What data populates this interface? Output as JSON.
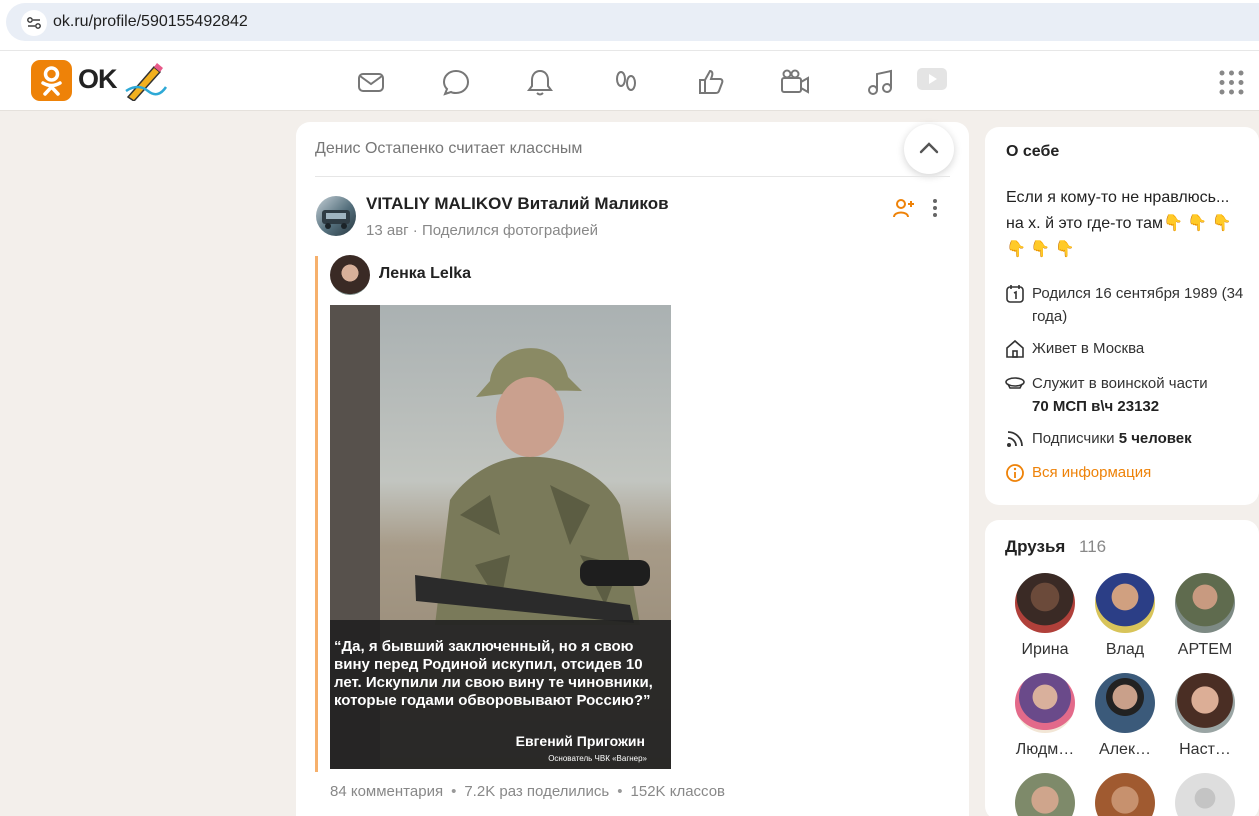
{
  "browser": {
    "url": "ok.ru/profile/590155492842"
  },
  "header": {
    "logo_text": "OK"
  },
  "feed": {
    "liked_by": "Денис Остапенко считает классным",
    "post": {
      "author": "VITALIY MALIKOV Виталий Маликов",
      "meta": "13 авг · Поделился фотографией",
      "repost_author": "Ленка Lelka",
      "photo_quote": "“Да, я бывший заключенный, но я свою вину перед Родиной искупил, отсидев 10 лет. Искупили ли свою вину те чиновники, которые годами обворовывают Россию?”",
      "photo_author": "Евгений Пригожин",
      "photo_author_role": "Основатель ЧВК «Вагнер»",
      "comments": "84 комментария",
      "shares": "7.2K раз поделились",
      "likes": "152K классов"
    }
  },
  "about": {
    "title": "О себе",
    "text": "Если я кому-то не нравлюсь... на х. й это где-то там👇 👇 👇 👇 👇 👇",
    "birthday": "Родился 16 сентября 1989 (34 года)",
    "lives": "Живет в Москва",
    "serves_prefix": "Служит в воинской части",
    "serves_unit": "70 МСП в\\ч 23132",
    "subscribers_prefix": "Подписчики",
    "subscribers_count": "5 человек",
    "all_info": "Вся информация"
  },
  "friends": {
    "title": "Друзья",
    "count": "116",
    "items": [
      {
        "name": "Ирина"
      },
      {
        "name": "Влад"
      },
      {
        "name": "АРТЕМ"
      },
      {
        "name": "Людм…"
      },
      {
        "name": "Алек…"
      },
      {
        "name": "Наст…"
      }
    ]
  }
}
